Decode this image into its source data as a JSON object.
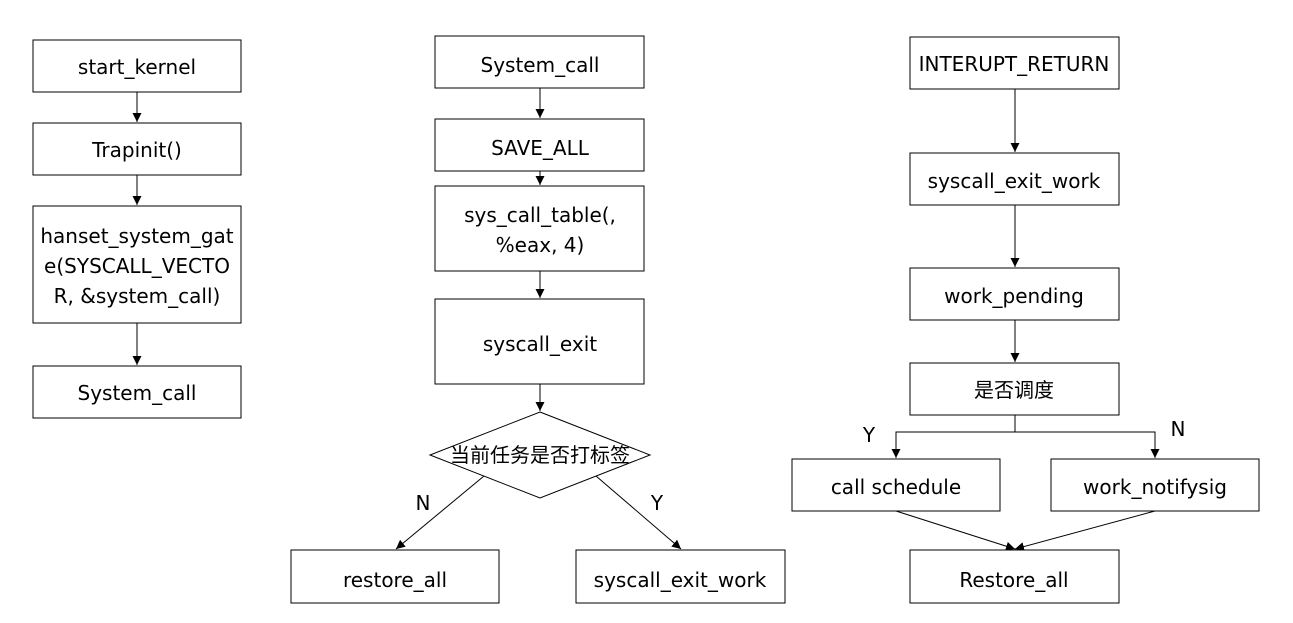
{
  "colors": {
    "stroke": "#000000",
    "background": "#ffffff",
    "text": "#000000"
  },
  "flow1": {
    "start_kernel": "start_kernel",
    "trapinit": "Trapinit()",
    "hanset_line1": "hanset_system_gat",
    "hanset_line2": "e(SYSCALL_VECTO",
    "hanset_line3": "R, &system_call)",
    "system_call": "System_call"
  },
  "flow2": {
    "system_call": "System_call",
    "save_all": "SAVE_ALL",
    "sys_call_table_line1": "sys_call_table(,",
    "sys_call_table_line2": "%eax, 4)",
    "syscall_exit": "syscall_exit",
    "decision": "当前任务是否打标签",
    "label_n": "N",
    "label_y": "Y",
    "restore_all": "restore_all",
    "syscall_exit_work": "syscall_exit_work"
  },
  "flow3": {
    "interupt_return": "INTERUPT_RETURN",
    "syscall_exit_work": "syscall_exit_work",
    "work_pending": "work_pending",
    "schedule_check": "是否调度",
    "label_y": "Y",
    "label_n": "N",
    "call_schedule": "call schedule",
    "work_notifysig": "work_notifysig",
    "restore_all": "Restore_all"
  }
}
